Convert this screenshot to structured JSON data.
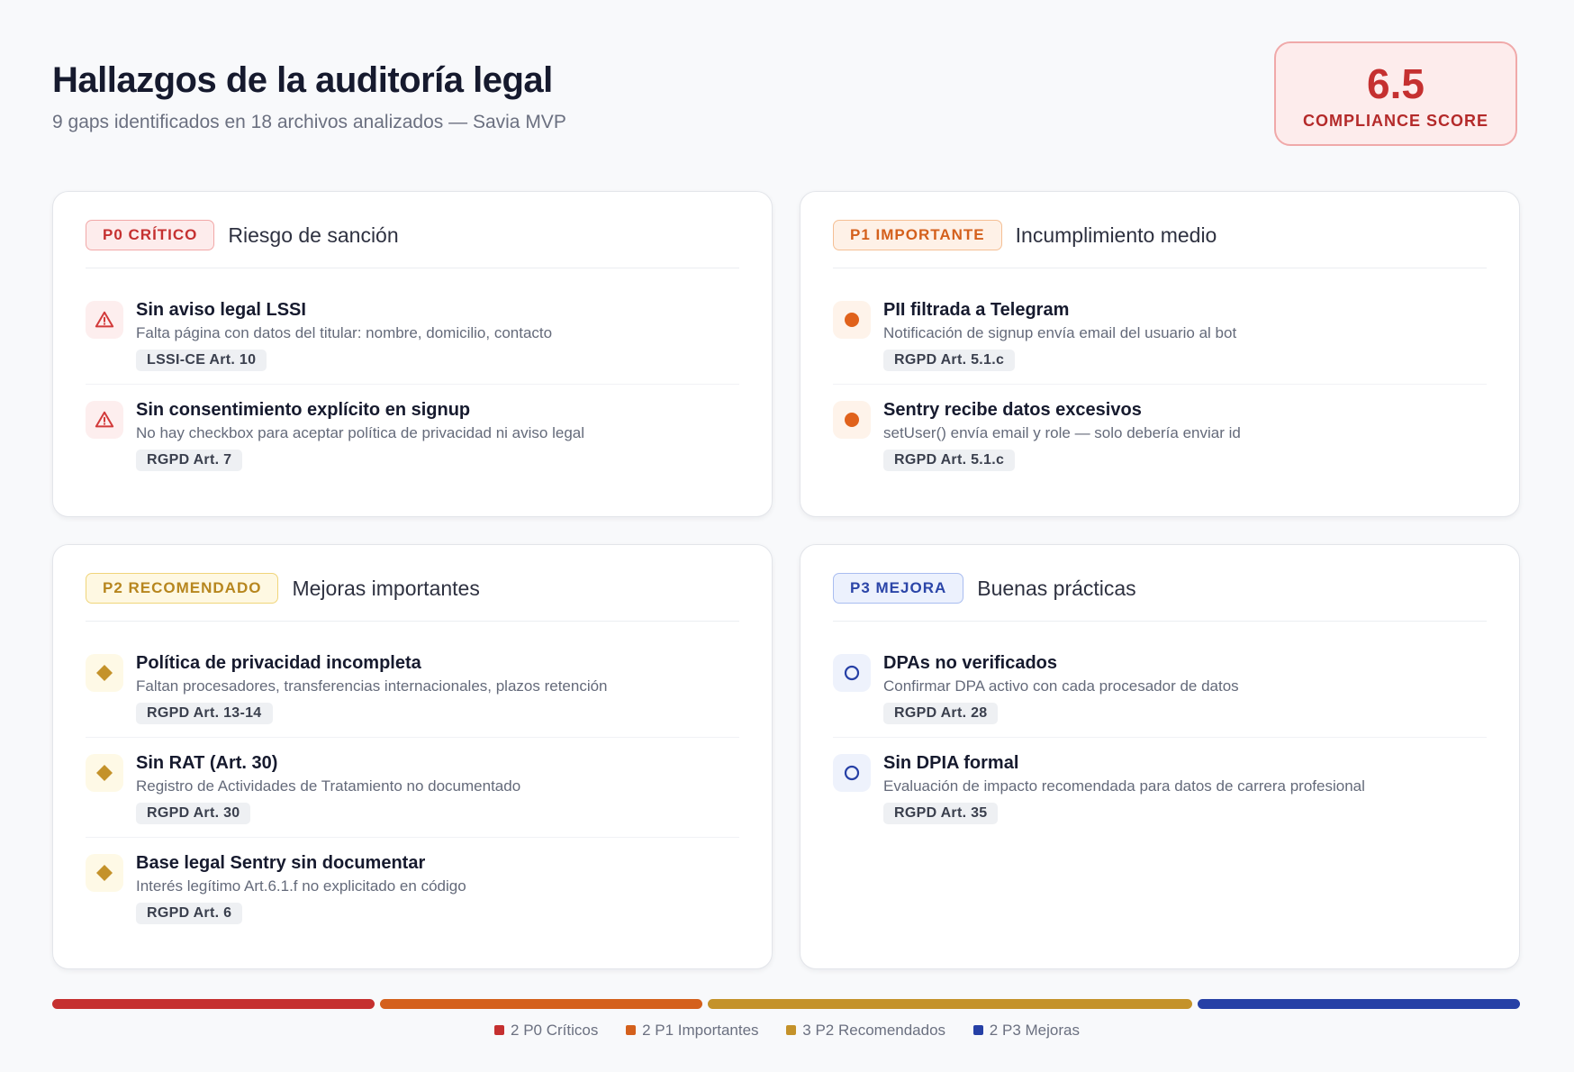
{
  "header": {
    "title": "Hallazgos de la auditoría legal",
    "subtitle": "9 gaps identificados en 18 archivos analizados — Savia MVP"
  },
  "score": {
    "value": "6.5",
    "label": "COMPLIANCE SCORE"
  },
  "colors": {
    "p0": "#c53030",
    "p1": "#d4601c",
    "p2": "#c4922a",
    "p3": "#2640a6"
  },
  "cards": [
    {
      "badge": "P0 CRÍTICO",
      "subtitle": "Riesgo de sanción",
      "icon": "warning-triangle-icon",
      "items": [
        {
          "title": "Sin aviso legal LSSI",
          "desc": "Falta página con datos del titular: nombre, domicilio, contacto",
          "ref": "LSSI-CE Art. 10"
        },
        {
          "title": "Sin consentimiento explícito en signup",
          "desc": "No hay checkbox para aceptar política de privacidad ni aviso legal",
          "ref": "RGPD Art. 7"
        }
      ]
    },
    {
      "badge": "P1 IMPORTANTE",
      "subtitle": "Incumplimiento medio",
      "icon": "filled-circle-icon",
      "items": [
        {
          "title": "PII filtrada a Telegram",
          "desc": "Notificación de signup envía email del usuario al bot",
          "ref": "RGPD Art. 5.1.c"
        },
        {
          "title": "Sentry recibe datos excesivos",
          "desc": "setUser() envía email y role — solo debería enviar id",
          "ref": "RGPD Art. 5.1.c"
        }
      ]
    },
    {
      "badge": "P2 RECOMENDADO",
      "subtitle": "Mejoras importantes",
      "icon": "diamond-icon",
      "items": [
        {
          "title": "Política de privacidad incompleta",
          "desc": "Faltan procesadores, transferencias internacionales, plazos retención",
          "ref": "RGPD Art. 13-14"
        },
        {
          "title": "Sin RAT (Art. 30)",
          "desc": "Registro de Actividades de Tratamiento no documentado",
          "ref": "RGPD Art. 30"
        },
        {
          "title": "Base legal Sentry sin documentar",
          "desc": "Interés legítimo Art.6.1.f no explicitado en código",
          "ref": "RGPD Art. 6"
        }
      ]
    },
    {
      "badge": "P3 MEJORA",
      "subtitle": "Buenas prácticas",
      "icon": "hollow-circle-icon",
      "items": [
        {
          "title": "DPAs no verificados",
          "desc": "Confirmar DPA activo con cada procesador de datos",
          "ref": "RGPD Art. 28"
        },
        {
          "title": "Sin DPIA formal",
          "desc": "Evaluación de impacto recomendada para datos de carrera profesional",
          "ref": "RGPD Art. 35"
        }
      ]
    }
  ],
  "summary": [
    {
      "label": "2 P0 Críticos",
      "count": 2
    },
    {
      "label": "2 P1 Importantes",
      "count": 2
    },
    {
      "label": "3 P2 Recomendados",
      "count": 3
    },
    {
      "label": "2 P3 Mejoras",
      "count": 2
    }
  ]
}
